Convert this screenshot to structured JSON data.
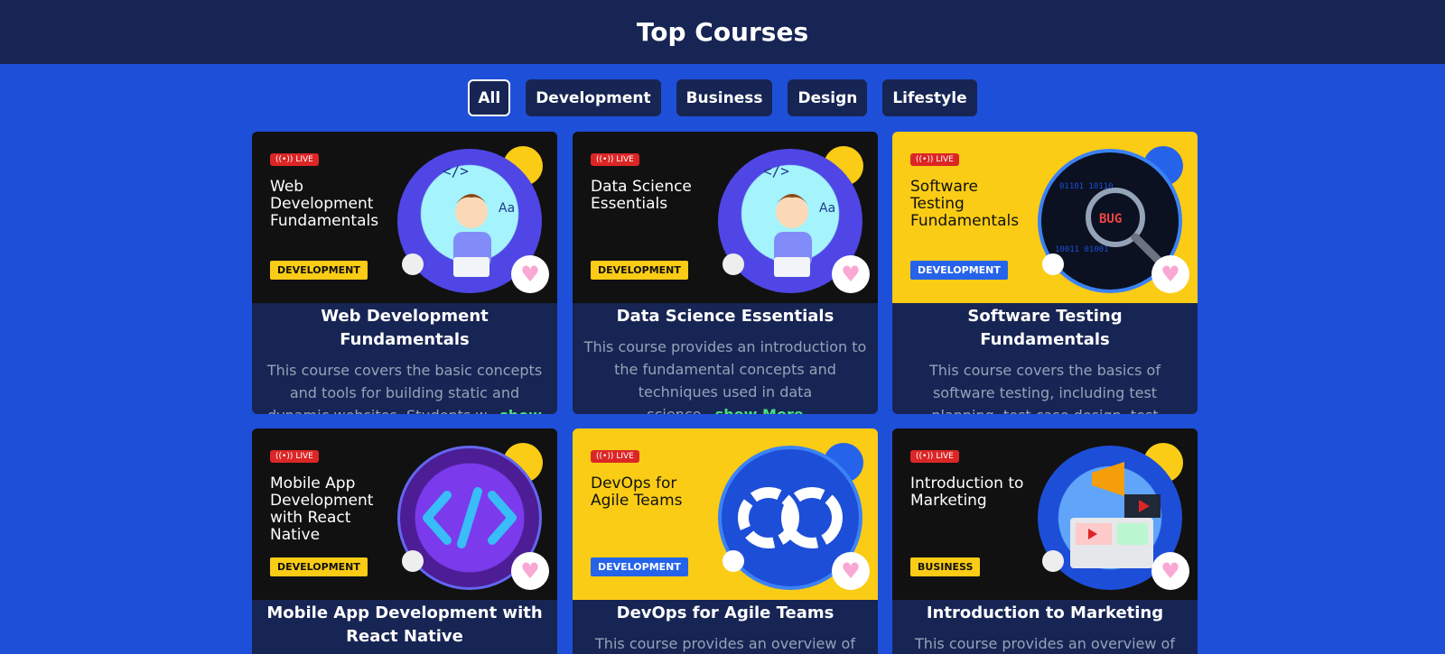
{
  "header": {
    "title": "Top Courses"
  },
  "filters": [
    "All",
    "Development",
    "Business",
    "Design",
    "Lifestyle"
  ],
  "live_label": "LIVE",
  "show_more_label": "show More",
  "courses": [
    {
      "thumb_title": "Web Development Fundamentals",
      "badge": "DEVELOPMENT",
      "title": "Web Development Fundamentals",
      "desc": "This course covers the basic concepts and tools for building static and dynamic websites. Students w..."
    },
    {
      "thumb_title": "Data Science Essentials",
      "badge": "DEVELOPMENT",
      "title": "Data Science Essentials",
      "desc": "This course provides an introduction to the fundamental concepts and techniques used in data science..."
    },
    {
      "thumb_title": "Software Testing Fundamentals",
      "badge": "DEVELOPMENT",
      "title": "Software Testing Fundamentals",
      "desc": "This course covers the basics of software testing, including test planning, test case design, test e..."
    },
    {
      "thumb_title": "Mobile App Development with React Native",
      "badge": "DEVELOPMENT",
      "title": "Mobile App Development with React Native",
      "desc": ""
    },
    {
      "thumb_title": "DevOps for Agile Teams",
      "badge": "DEVELOPMENT",
      "title": "DevOps for Agile Teams",
      "desc": "This course provides an overview of DevOps"
    },
    {
      "thumb_title": "Introduction to Marketing",
      "badge": "BUSINESS",
      "title": "Introduction to Marketing",
      "desc": "This course provides an overview of"
    }
  ]
}
